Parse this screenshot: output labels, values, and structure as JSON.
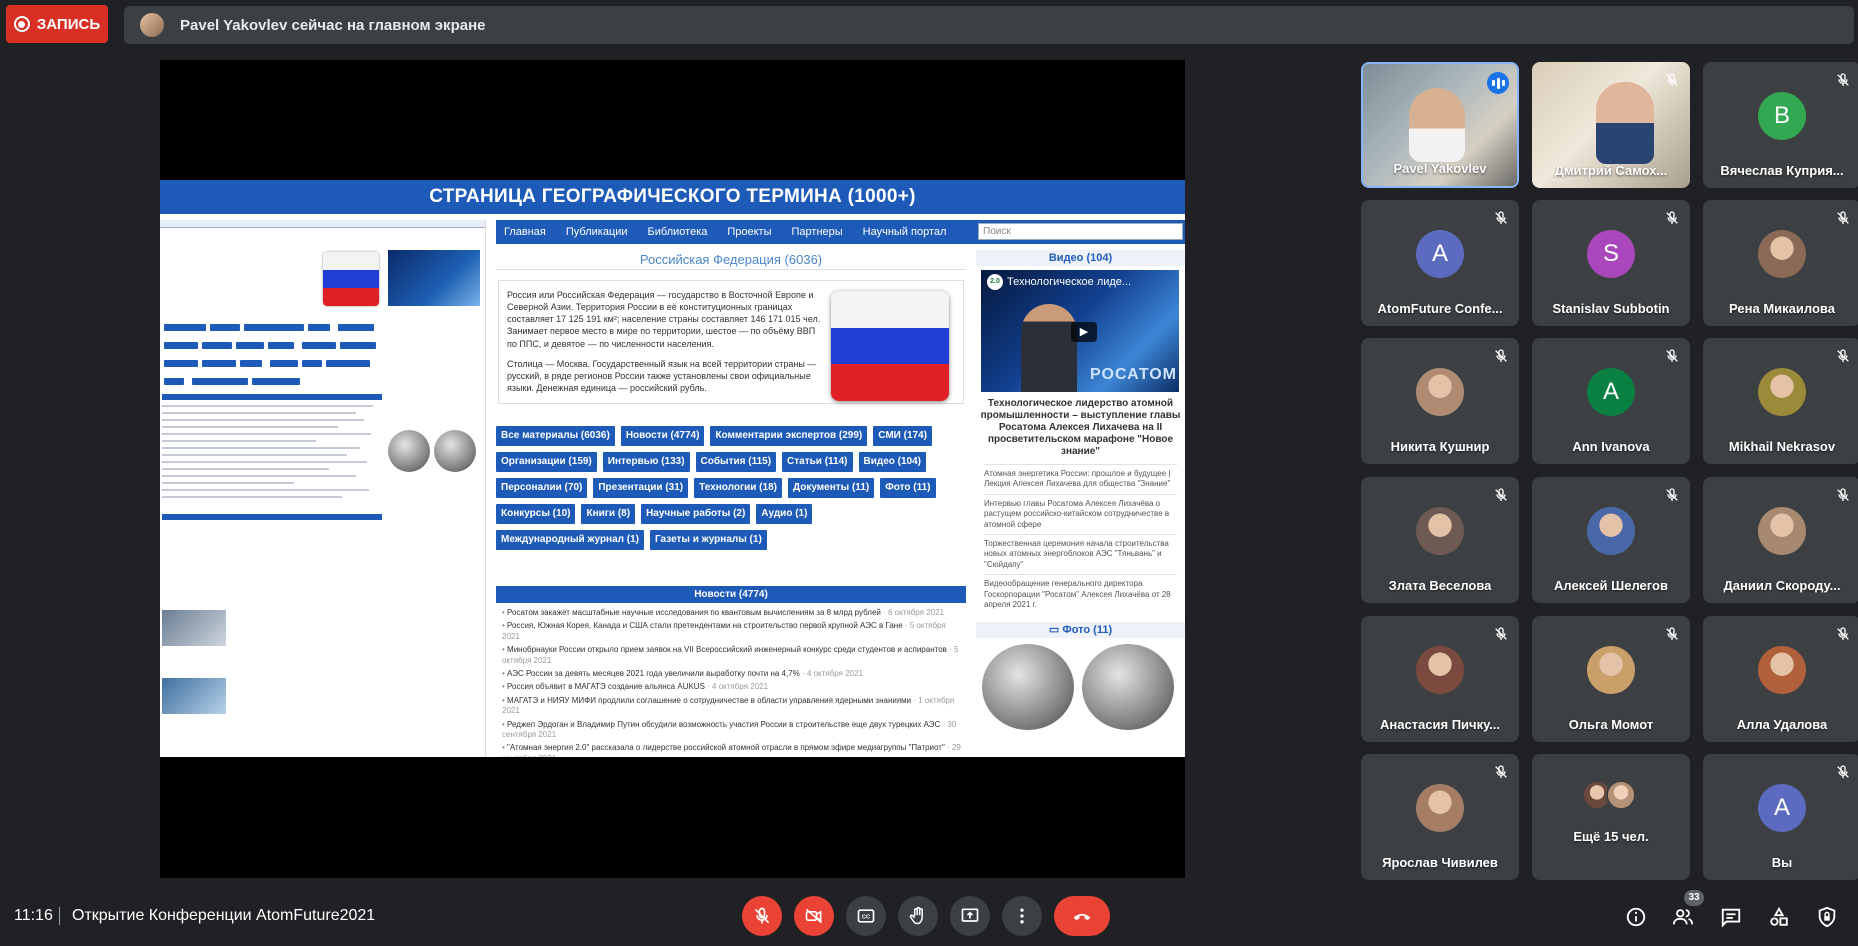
{
  "recording": {
    "label": "ЗАПИСЬ"
  },
  "presenting_banner": {
    "text": "Pavel Yakovlev сейчас на главном экране"
  },
  "slide": {
    "title": "СТРАНИЦА ГЕОГРАФИЧЕСКОГО ТЕРМИНА (1000+)",
    "site": {
      "nav": [
        "Главная",
        "Публикации",
        "Библиотека",
        "Проекты",
        "Партнеры",
        "Научный портал"
      ],
      "search_placeholder": "Поиск",
      "main_title": "Российская Федерация (6036)",
      "intro_p1": "Россия или Российская Федерация — государство в Восточной Европе и Северной Азии. Территория России в её конституционных границах составляет 17 125 191 км²; население страны составляет 146 171 015 чел. Занимает первое место в мире по территории, шестое — по объёму ВВП по ППС, и девятое — по численности населения.",
      "intro_p2": "Столица — Москва. Государственный язык на всей территории страны — русский, в ряде регионов России также установлены свои официальные языки. Денежная единица — российский рубль.",
      "chips": [
        "Все материалы (6036)",
        "Новости (4774)",
        "Комментарии экспертов (299)",
        "СМИ (174)",
        "Организации (159)",
        "Интервью (133)",
        "События (115)",
        "Статьи (114)",
        "Видео (104)",
        "Персоналии (70)",
        "Презентации (31)",
        "Технологии (18)",
        "Документы (11)",
        "Фото (11)",
        "Конкурсы (10)",
        "Книги (8)",
        "Научные работы (2)",
        "Аудио (1)",
        "Международный журнал (1)",
        "Газеты и журналы (1)"
      ],
      "news_title": "Новости (4774)",
      "news": [
        {
          "text": "Росатом закажет масштабные научные исследования по квантовым вычислениям за 8 млрд рублей",
          "date": "· 6 октября 2021"
        },
        {
          "text": "Россия, Южная Корея, Канада и США стали претендентами на строительство первой крупной АЭС в Гане",
          "date": "· 5 октября 2021"
        },
        {
          "text": "Минобрнауки России открыло прием заявок на VII Всероссийский инженерный конкурс среди студентов и аспирантов",
          "date": "· 5 октября 2021"
        },
        {
          "text": "АЭС России за девять месяцев 2021 года увеличили выработку почти на 4,7%",
          "date": "· 4 октября 2021"
        },
        {
          "text": "Россия объявит в МАГАТЭ создание альянса AUKUS",
          "date": "· 4 октября 2021"
        },
        {
          "text": "МАГАТЭ и НИЯУ МИФИ продлили соглашение о сотрудничестве в области управления ядерными знаниями",
          "date": "· 1 октября 2021"
        },
        {
          "text": "Реджеп Эрдоган и Владимир Путин обсудили возможность участия России в строительстве еще двух турецких АЭС",
          "date": "· 30 сентября 2021"
        },
        {
          "text": "\"Атомная энергия 2.0\" рассказала о лидерстве российской атомной отрасли в прямом эфире медиагруппы \"Патриот\"",
          "date": "· 29 сентября 2021"
        }
      ],
      "video_title": "Видео (104)",
      "video_overlay": "Технологическое лиде...",
      "video_brand": "РОСАТОМ",
      "video_caption": "Технологическое лидерство атомной промышленности – выступление главы Росатома Алексея Лихачева на II просветительском марафоне \"Новое знание\"",
      "side_news": [
        "Атомная энергетика России: прошлое и будущее | Лекция Алексея Лихачева для общества \"Знание\"",
        "Интервью главы Росатома Алексея Лихачёва о растущем российско-китайском сотрудничестве в атомной сфере",
        "Торжественная церемония начала строительства новых атомных энергоблоков АЭС \"Тяньвань\" и \"Сюйдапу\"",
        "Видеообращение генерального директора Госкорпорации \"Росатом\" Алексея Лихачёва от 28 апреля 2021 г."
      ],
      "photo_title": "Фото (11)"
    }
  },
  "participants": [
    {
      "name": "Pavel Yakovlev",
      "type": "video",
      "speaking": true
    },
    {
      "name": "Дмитрий Самох...",
      "type": "video",
      "muted": true
    },
    {
      "name": "Вячеслав Куприя...",
      "type": "letter",
      "letter": "B",
      "color": "#33a852",
      "muted": true
    },
    {
      "name": "AtomFuture Confe...",
      "type": "letter",
      "letter": "A",
      "color": "#5c6bc0",
      "muted": true
    },
    {
      "name": "Stanislav Subbotin",
      "type": "letter",
      "letter": "S",
      "color": "#ab47bc",
      "muted": true
    },
    {
      "name": "Рена Микаилова",
      "type": "photo",
      "color": "#8a6a57",
      "muted": true
    },
    {
      "name": "Никита Кушнир",
      "type": "photo",
      "color": "#b08a73",
      "muted": true
    },
    {
      "name": "Ann Ivanova",
      "type": "letter",
      "letter": "A",
      "color": "#0b8043",
      "muted": true
    },
    {
      "name": "Mikhail Nekrasov",
      "type": "photo",
      "color": "#9a8a3a",
      "muted": true
    },
    {
      "name": "Злата Веселова",
      "type": "photo",
      "color": "#6d5a52",
      "muted": true
    },
    {
      "name": "Алексей Шелегов",
      "type": "photo",
      "color": "#4a68a8",
      "muted": true
    },
    {
      "name": "Даниил Скороду...",
      "type": "photo",
      "color": "#a7896f",
      "muted": true
    },
    {
      "name": "Анастасия Пичку...",
      "type": "photo",
      "color": "#7a4a3e",
      "muted": true
    },
    {
      "name": "Ольга Момот",
      "type": "photo",
      "color": "#c9a06a",
      "muted": true
    },
    {
      "name": "Алла Удалова",
      "type": "photo",
      "color": "#b0603a",
      "muted": true
    },
    {
      "name": "Ярослав Чивилев",
      "type": "photo",
      "color": "#a57d64",
      "muted": true
    },
    {
      "name": "Ещё 15 чел.",
      "type": "more"
    },
    {
      "name": "Вы",
      "type": "letter",
      "letter": "A",
      "color": "#5c6bc0",
      "muted": true
    }
  ],
  "bottom": {
    "time": "11:16",
    "meeting_title": "Открытие Конференции AtomFuture2021",
    "participant_count": "33"
  },
  "colors": {
    "background": "#202124",
    "tile": "#3c4043",
    "accent": "#1a73e8",
    "danger": "#ea4335",
    "site_blue": "#1e5bb8"
  }
}
